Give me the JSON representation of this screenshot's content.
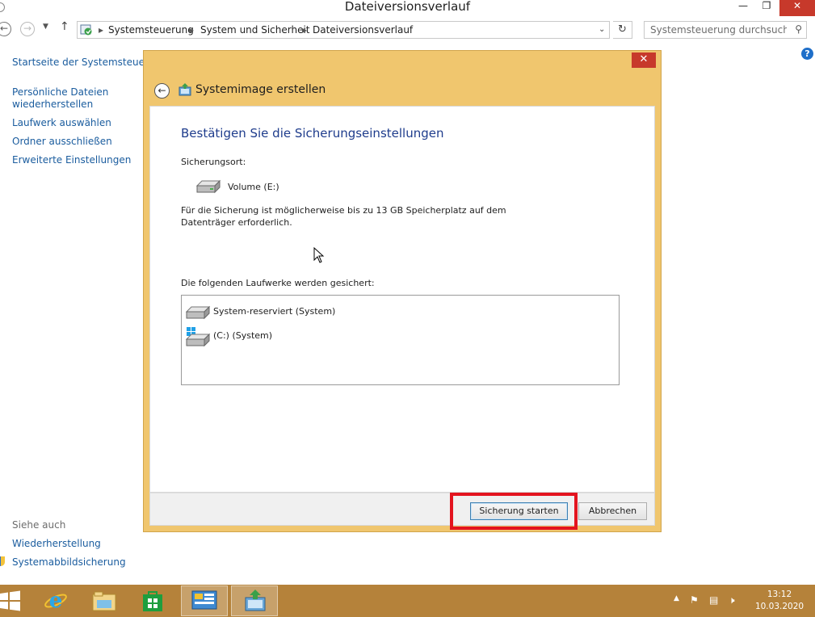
{
  "window": {
    "title": "Dateiversionsverlauf"
  },
  "address": {
    "breadcrumbs": [
      "Systemsteuerung",
      "System und Sicherheit",
      "Dateiversionsverlauf"
    ],
    "search_placeholder": "Systemsteuerung durchsuchen"
  },
  "left_pane": {
    "home_link": "Startseite der Systemsteuerung",
    "links": [
      "Persönliche Dateien",
      "wiederherstellen",
      "Laufwerk auswählen",
      "Ordner ausschließen",
      "Erweiterte Einstellungen"
    ],
    "see_also_heading": "Siehe auch",
    "see_also": [
      "Wiederherstellung",
      "Systemabbildsicherung"
    ]
  },
  "dialog": {
    "title": "Systemimage erstellen",
    "heading": "Bestätigen Sie die Sicherungseinstellungen",
    "location_label": "Sicherungsort:",
    "location_value": "Volume (E:)",
    "space_text": "Für die Sicherung ist möglicherweise bis zu 13 GB Speicherplatz auf dem Datenträger erforderlich.",
    "drives_label": "Die folgenden Laufwerke werden gesichert:",
    "drives": [
      "System-reserviert (System)",
      "(C:) (System)"
    ],
    "start_button": "Sicherung starten",
    "cancel_button": "Abbrechen"
  },
  "taskbar": {
    "time": "13:12",
    "date": "10.03.2020",
    "items": [
      "windows-start",
      "internet-explorer",
      "file-explorer",
      "store",
      "control-panel",
      "backup-tool"
    ]
  },
  "colors": {
    "dialog_frame": "#f0c66e",
    "taskbar": "#b5823a",
    "close": "#c7392b",
    "highlight": "#e3141f",
    "link": "#1a5c9e",
    "heading": "#1e3c8c"
  }
}
